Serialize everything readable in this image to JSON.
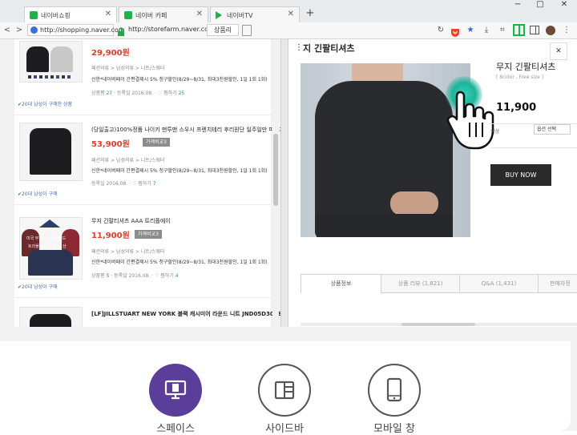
{
  "tabs": [
    {
      "label": "네이버쇼핑",
      "favicon_color": "#1fb14a"
    },
    {
      "label": "네이버 카페",
      "favicon_color": "#1fb14a"
    },
    {
      "label": "네이버TV",
      "favicon_color": "#1fb14a"
    }
  ],
  "tab_close_glyph": "✕",
  "new_tab_glyph": "+",
  "window_controls": [
    "−",
    "□",
    "✕"
  ],
  "address": {
    "back_glyph": "<",
    "forward_glyph": ">",
    "left_url": "http://shopping.naver.com",
    "right_url": "http://storefarm.naver.com",
    "split_label": "상품리"
  },
  "products": [
    {
      "title": "",
      "price": "29,900원",
      "compare": "",
      "category": "패션의류 > 남성의류 > 니트/스웨터",
      "promo": "신한*네이버페이 간편결제시 5% 청구할인(8/29~8/31, 최대3천원할인, 1일 1회 1회)",
      "meta_prefix": "상품평",
      "reviews": "27",
      "date": "등록일 2016.08.",
      "wish_label": "찜하기",
      "wishes": "25",
      "buyers": "✔20대 남성이 구매한 상품"
    },
    {
      "title": "(당일출고)100%정품 나이키 맨투맨 스우시 프렌치테리 후리원단 일주일만 파격가",
      "price": "53,900원",
      "compare": "가격비교3",
      "category": "패션의류 > 남성의류 > 니트/스웨터",
      "promo": "신한*네이버페이 간편결제시 5% 청구할인(8/29~8/31, 최대3천원할인, 1일 1회 1회)",
      "meta_prefix": "",
      "reviews": "",
      "date": "등록일 2016.08.",
      "wish_label": "찜하기",
      "wishes": "7",
      "buyers": "✔20대 남성이 구매"
    },
    {
      "title": "무지 긴팔티셔츠 AAA 트리플에이",
      "price": "11,900원",
      "compare": "가격비교3",
      "category": "패션의류 > 남성의류 > 니트/스웨터",
      "promo": "신한*네이버페이 간편결제시 5% 청구할인(8/29~8/31, 최대3천원할인, 1일 1회 1회)",
      "meta_prefix": "상품평",
      "reviews": "5",
      "date": "등록일 2016.08.",
      "wish_label": "찜하기",
      "wishes": "4",
      "buyers": "✔20대 남성이 구매",
      "overlay1": "미국 무지티 1위 브랜드",
      "overlay2": "트리플에이 국 내 생 산"
    },
    {
      "title": "[LF]JILLSTUART NEW YORK 블랙 캐시미어 라운드 니트 JND05D302BK",
      "price": "",
      "compare": "",
      "category": "",
      "promo": "",
      "meta_prefix": "",
      "reviews": "",
      "date": "",
      "wish_label": "",
      "wishes": "",
      "buyers": ""
    }
  ],
  "detail": {
    "header_title": "지 긴팔티셔츠",
    "menu_glyph": "⋮",
    "close_glyph": "✕",
    "name": "무지 긴팔티셔츠",
    "option_hint": "[ 8color , Free size ]",
    "price": "11,900",
    "option_label": "색상",
    "option_select": "옵션 선택",
    "buy_label": "BUY NOW",
    "tabs": [
      "상품정보",
      "상품 리뷰 (1,821)",
      "Q&A (1,431)",
      "판매자정"
    ]
  },
  "modes": [
    {
      "label": "스페이스",
      "active": true
    },
    {
      "label": "사이드바",
      "active": false
    },
    {
      "label": "모바일 창",
      "active": false
    }
  ],
  "colors": {
    "accent": "#5a3e9a",
    "price": "#e33a2a",
    "review_green": "#2aa146",
    "toggle_green": "#1fb14a"
  }
}
